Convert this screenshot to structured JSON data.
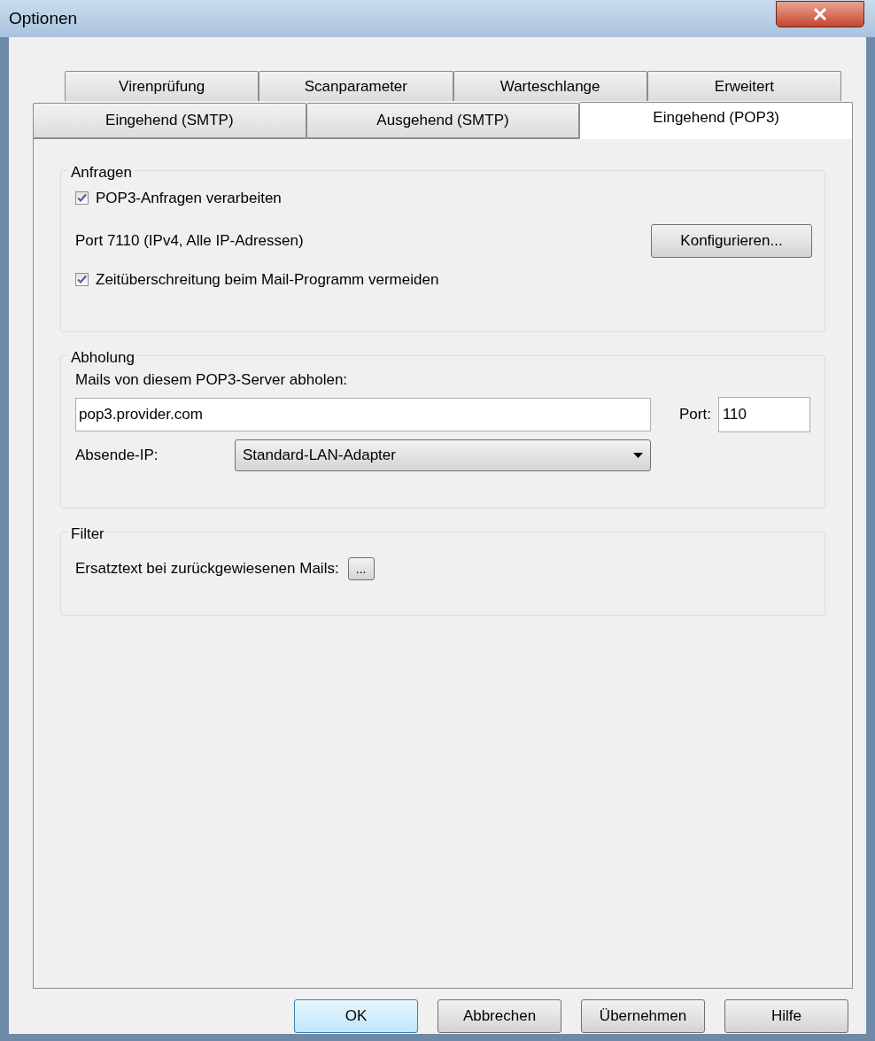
{
  "window": {
    "title": "Optionen"
  },
  "tab_rows": [
    [
      {
        "label": "Virenprüfung",
        "selected": false
      },
      {
        "label": "Scanparameter",
        "selected": false
      },
      {
        "label": "Warteschlange",
        "selected": false
      },
      {
        "label": "Erweitert",
        "selected": false
      }
    ],
    [
      {
        "label": "Eingehend (SMTP)",
        "selected": false
      },
      {
        "label": "Ausgehend (SMTP)",
        "selected": false
      },
      {
        "label": "Eingehend (POP3)",
        "selected": true
      }
    ]
  ],
  "anfragen": {
    "title": "Anfragen",
    "process_checkbox": {
      "label": "POP3-Anfragen verarbeiten",
      "checked": true
    },
    "port_text": "Port 7110 (IPv4, Alle IP-Adressen)",
    "configure_button": "Konfigurieren...",
    "timeout_checkbox": {
      "label": "Zeitüberschreitung beim Mail-Programm vermeiden",
      "checked": true
    }
  },
  "abholung": {
    "title": "Abholung",
    "server_label": "Mails von diesem POP3-Server abholen:",
    "server_value": "pop3.provider.com",
    "port_label": "Port:",
    "port_value": "110",
    "ip_label": "Absende-IP:",
    "ip_value": "Standard-LAN-Adapter"
  },
  "filter": {
    "title": "Filter",
    "replacement_label": "Ersatztext bei zurückgewiesenen Mails:",
    "browse_button": "..."
  },
  "buttons": [
    {
      "label": "OK",
      "default": true
    },
    {
      "label": "Abbrechen",
      "default": false
    },
    {
      "label": "Übernehmen",
      "default": false
    },
    {
      "label": "Hilfe",
      "default": false
    }
  ]
}
